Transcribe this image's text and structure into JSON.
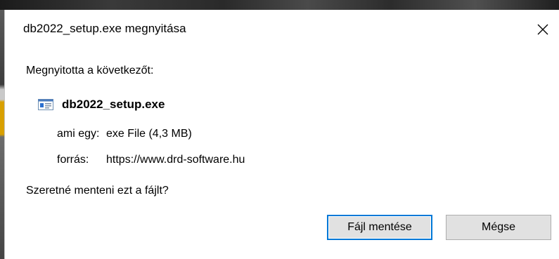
{
  "dialog": {
    "title": "db2022_setup.exe megnyitása",
    "intro": "Megnyitotta a következőt:",
    "file_name": "db2022_setup.exe",
    "type_label": "ami egy:",
    "type_value": "exe File (4,3 MB)",
    "source_label": "forrás:",
    "source_value": "https://www.drd-software.hu",
    "question": "Szeretné menteni ezt a fájlt?",
    "save_button": "Fájl mentése",
    "cancel_button": "Mégse"
  },
  "icons": {
    "close": "close-icon",
    "file": "exe-file-icon"
  },
  "colors": {
    "focus_border": "#0078d7",
    "button_bg": "#e1e1e1"
  }
}
